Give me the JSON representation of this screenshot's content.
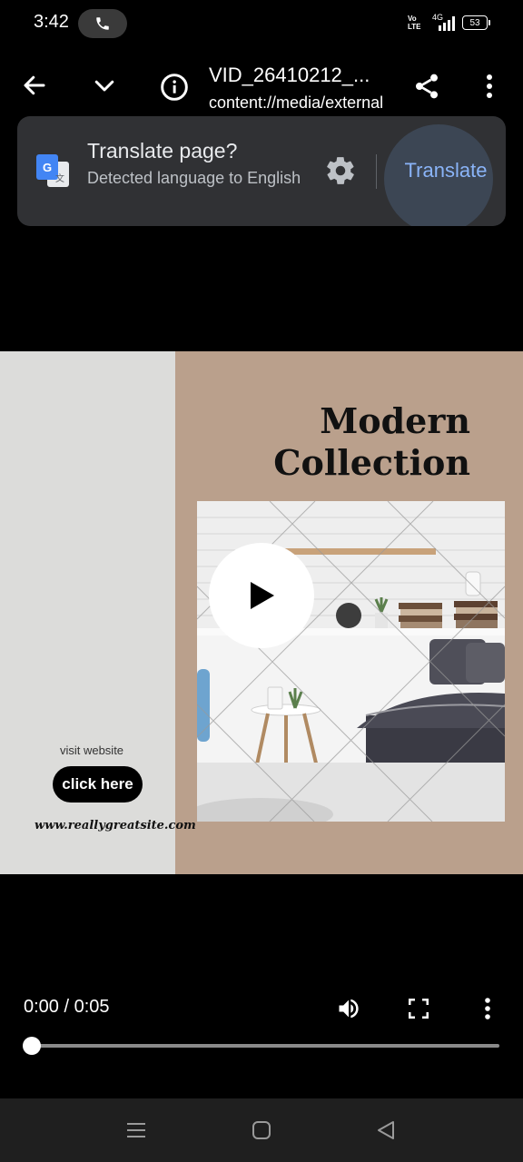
{
  "status_bar": {
    "time": "3:42",
    "volte": "Vo\nLTE",
    "network": "4G",
    "battery": "53"
  },
  "toolbar": {
    "title": "VID_26410212_...",
    "url": "content://media/external"
  },
  "translate_bar": {
    "title": "Translate page?",
    "subtitle": "Detected language to English",
    "button_label": "Translate"
  },
  "video": {
    "heading_line1": "Modern",
    "heading_line2": "Collection",
    "visit_text": "visit website",
    "cta_label": "click here",
    "site_url": "www.reallygreatsite.com"
  },
  "player": {
    "time": "0:00 / 0:05",
    "progress_fraction": 0.0
  },
  "colors": {
    "accent": "#8ab4f8",
    "card_bg": "#303134",
    "video_left_bg": "#dcdcda",
    "video_right_bg": "#baa08c"
  },
  "icons": [
    "back-arrow-icon",
    "chevron-down-icon",
    "info-icon",
    "share-icon",
    "more-vert-icon",
    "google-translate-icon",
    "gear-icon",
    "play-icon",
    "volume-icon",
    "fullscreen-icon",
    "menu-lines-icon",
    "home-square-icon",
    "back-triangle-icon",
    "phone-icon"
  ]
}
